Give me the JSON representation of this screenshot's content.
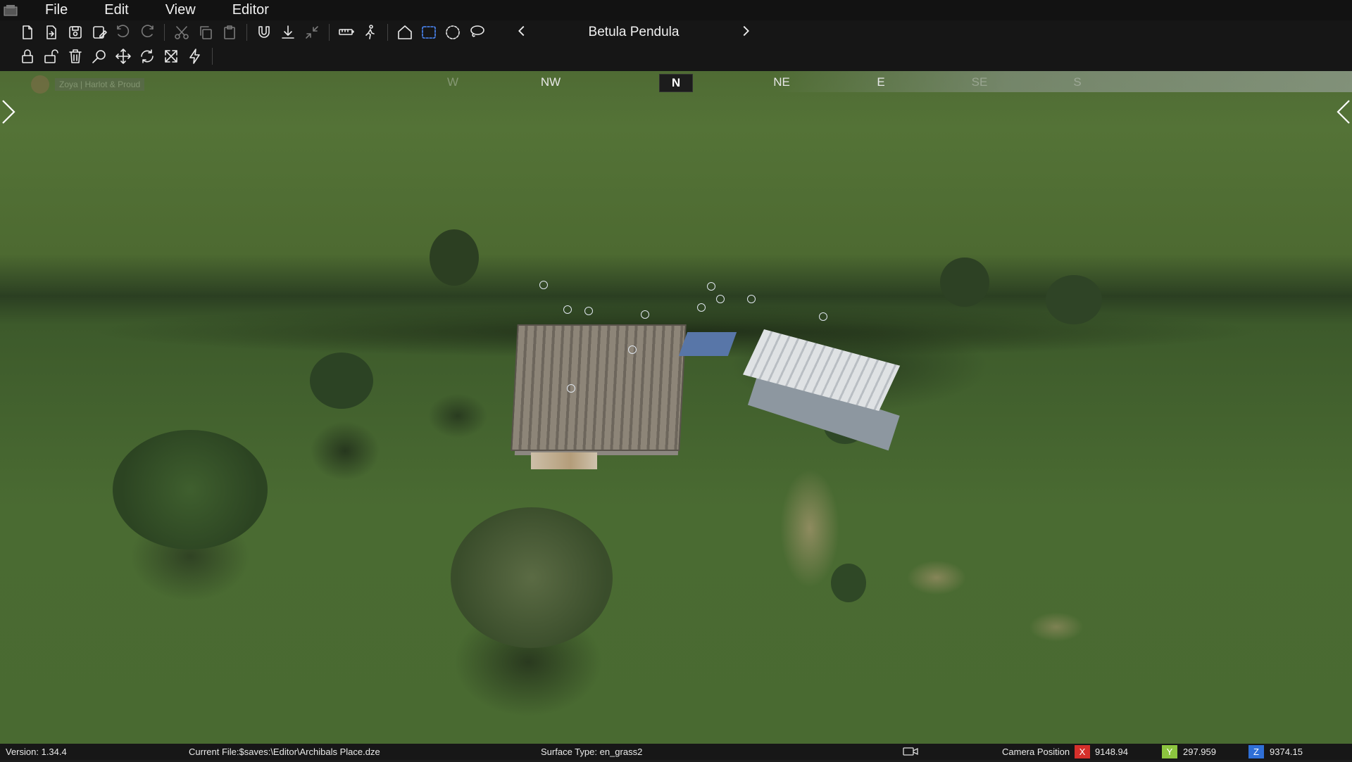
{
  "menu": {
    "items": [
      {
        "label": "File"
      },
      {
        "label": "Edit"
      },
      {
        "label": "View"
      },
      {
        "label": "Editor"
      }
    ]
  },
  "toolbar": {
    "row1_icons": [
      "new-file-icon",
      "open-file-icon",
      "save-icon",
      "save-as-icon",
      "undo-icon",
      "redo-icon",
      "cut-icon",
      "copy-icon",
      "paste-icon",
      "magnet-icon",
      "drop-to-ground-icon",
      "collapse-icon",
      "ruler-icon",
      "walk-icon",
      "home-icon",
      "box-select-icon",
      "circle-select-icon",
      "lasso-select-icon"
    ],
    "row2_icons": [
      "lock-icon",
      "unlock-icon",
      "trash-icon",
      "zoom-icon",
      "move-icon",
      "rotate-icon",
      "scale-icon",
      "lightning-icon"
    ],
    "prefab_name": "Betula Pendula",
    "active_tool": "box-select-icon",
    "accent": "#4d8cff"
  },
  "compass": {
    "labels": [
      {
        "text": "W",
        "state": "faded"
      },
      {
        "text": "NW",
        "state": "normal"
      },
      {
        "text": "N",
        "state": "current"
      },
      {
        "text": "NE",
        "state": "normal"
      },
      {
        "text": "E",
        "state": "normal"
      },
      {
        "text": "SE",
        "state": "faded"
      },
      {
        "text": "S",
        "state": "faded"
      }
    ],
    "faded_hint": "Zoya | Harlot & Proud"
  },
  "status": {
    "version": "Version:  1.34.4",
    "current_file": "Current File:$saves:\\Editor\\Archibals Place.dze",
    "surface_type": "Surface Type: en_grass2",
    "camera_label": "Camera Position",
    "x_label": "X",
    "x_value": "9148.94",
    "y_label": "Y",
    "y_value": "297.959",
    "z_label": "Z",
    "z_value": "9374.15",
    "x_color": "#d6302b",
    "y_color": "#8cc43f",
    "z_color": "#2f6fd6"
  }
}
